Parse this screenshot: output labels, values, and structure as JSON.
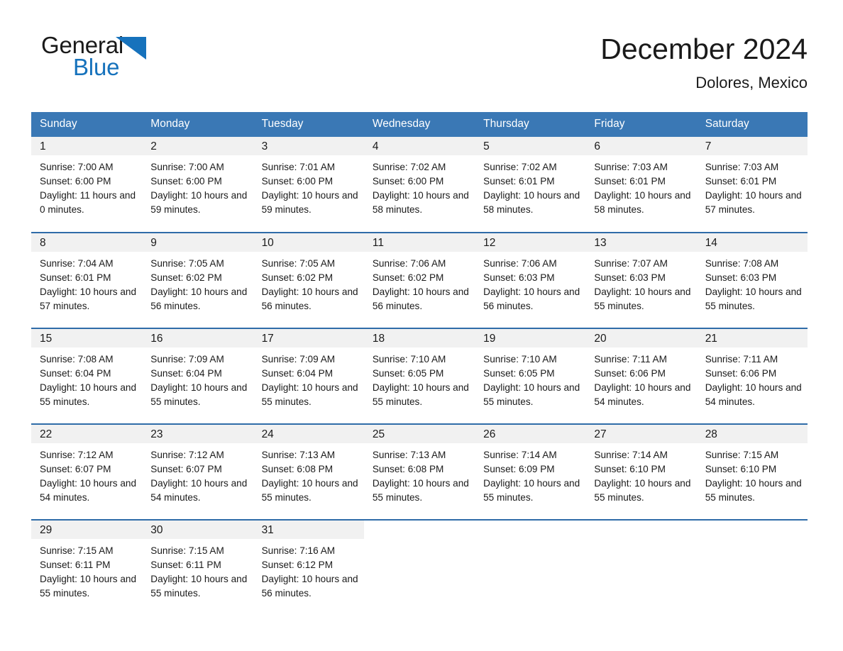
{
  "brand": {
    "name_part1": "General",
    "name_part2": "Blue",
    "triangle_color": "#1672bc"
  },
  "header": {
    "title": "December 2024",
    "location": "Dolores, Mexico"
  },
  "theme": {
    "header_bg": "#3a78b5",
    "header_text": "#ffffff",
    "week_divider": "#2f6ca8",
    "daynum_bg": "#f1f1f1",
    "text": "#1a1a1a"
  },
  "weekday_headers": [
    "Sunday",
    "Monday",
    "Tuesday",
    "Wednesday",
    "Thursday",
    "Friday",
    "Saturday"
  ],
  "weeks": [
    [
      {
        "day": "1",
        "sunrise": "Sunrise: 7:00 AM",
        "sunset": "Sunset: 6:00 PM",
        "daylight": "Daylight: 11 hours and 0 minutes."
      },
      {
        "day": "2",
        "sunrise": "Sunrise: 7:00 AM",
        "sunset": "Sunset: 6:00 PM",
        "daylight": "Daylight: 10 hours and 59 minutes."
      },
      {
        "day": "3",
        "sunrise": "Sunrise: 7:01 AM",
        "sunset": "Sunset: 6:00 PM",
        "daylight": "Daylight: 10 hours and 59 minutes."
      },
      {
        "day": "4",
        "sunrise": "Sunrise: 7:02 AM",
        "sunset": "Sunset: 6:00 PM",
        "daylight": "Daylight: 10 hours and 58 minutes."
      },
      {
        "day": "5",
        "sunrise": "Sunrise: 7:02 AM",
        "sunset": "Sunset: 6:01 PM",
        "daylight": "Daylight: 10 hours and 58 minutes."
      },
      {
        "day": "6",
        "sunrise": "Sunrise: 7:03 AM",
        "sunset": "Sunset: 6:01 PM",
        "daylight": "Daylight: 10 hours and 58 minutes."
      },
      {
        "day": "7",
        "sunrise": "Sunrise: 7:03 AM",
        "sunset": "Sunset: 6:01 PM",
        "daylight": "Daylight: 10 hours and 57 minutes."
      }
    ],
    [
      {
        "day": "8",
        "sunrise": "Sunrise: 7:04 AM",
        "sunset": "Sunset: 6:01 PM",
        "daylight": "Daylight: 10 hours and 57 minutes."
      },
      {
        "day": "9",
        "sunrise": "Sunrise: 7:05 AM",
        "sunset": "Sunset: 6:02 PM",
        "daylight": "Daylight: 10 hours and 56 minutes."
      },
      {
        "day": "10",
        "sunrise": "Sunrise: 7:05 AM",
        "sunset": "Sunset: 6:02 PM",
        "daylight": "Daylight: 10 hours and 56 minutes."
      },
      {
        "day": "11",
        "sunrise": "Sunrise: 7:06 AM",
        "sunset": "Sunset: 6:02 PM",
        "daylight": "Daylight: 10 hours and 56 minutes."
      },
      {
        "day": "12",
        "sunrise": "Sunrise: 7:06 AM",
        "sunset": "Sunset: 6:03 PM",
        "daylight": "Daylight: 10 hours and 56 minutes."
      },
      {
        "day": "13",
        "sunrise": "Sunrise: 7:07 AM",
        "sunset": "Sunset: 6:03 PM",
        "daylight": "Daylight: 10 hours and 55 minutes."
      },
      {
        "day": "14",
        "sunrise": "Sunrise: 7:08 AM",
        "sunset": "Sunset: 6:03 PM",
        "daylight": "Daylight: 10 hours and 55 minutes."
      }
    ],
    [
      {
        "day": "15",
        "sunrise": "Sunrise: 7:08 AM",
        "sunset": "Sunset: 6:04 PM",
        "daylight": "Daylight: 10 hours and 55 minutes."
      },
      {
        "day": "16",
        "sunrise": "Sunrise: 7:09 AM",
        "sunset": "Sunset: 6:04 PM",
        "daylight": "Daylight: 10 hours and 55 minutes."
      },
      {
        "day": "17",
        "sunrise": "Sunrise: 7:09 AM",
        "sunset": "Sunset: 6:04 PM",
        "daylight": "Daylight: 10 hours and 55 minutes."
      },
      {
        "day": "18",
        "sunrise": "Sunrise: 7:10 AM",
        "sunset": "Sunset: 6:05 PM",
        "daylight": "Daylight: 10 hours and 55 minutes."
      },
      {
        "day": "19",
        "sunrise": "Sunrise: 7:10 AM",
        "sunset": "Sunset: 6:05 PM",
        "daylight": "Daylight: 10 hours and 55 minutes."
      },
      {
        "day": "20",
        "sunrise": "Sunrise: 7:11 AM",
        "sunset": "Sunset: 6:06 PM",
        "daylight": "Daylight: 10 hours and 54 minutes."
      },
      {
        "day": "21",
        "sunrise": "Sunrise: 7:11 AM",
        "sunset": "Sunset: 6:06 PM",
        "daylight": "Daylight: 10 hours and 54 minutes."
      }
    ],
    [
      {
        "day": "22",
        "sunrise": "Sunrise: 7:12 AM",
        "sunset": "Sunset: 6:07 PM",
        "daylight": "Daylight: 10 hours and 54 minutes."
      },
      {
        "day": "23",
        "sunrise": "Sunrise: 7:12 AM",
        "sunset": "Sunset: 6:07 PM",
        "daylight": "Daylight: 10 hours and 54 minutes."
      },
      {
        "day": "24",
        "sunrise": "Sunrise: 7:13 AM",
        "sunset": "Sunset: 6:08 PM",
        "daylight": "Daylight: 10 hours and 55 minutes."
      },
      {
        "day": "25",
        "sunrise": "Sunrise: 7:13 AM",
        "sunset": "Sunset: 6:08 PM",
        "daylight": "Daylight: 10 hours and 55 minutes."
      },
      {
        "day": "26",
        "sunrise": "Sunrise: 7:14 AM",
        "sunset": "Sunset: 6:09 PM",
        "daylight": "Daylight: 10 hours and 55 minutes."
      },
      {
        "day": "27",
        "sunrise": "Sunrise: 7:14 AM",
        "sunset": "Sunset: 6:10 PM",
        "daylight": "Daylight: 10 hours and 55 minutes."
      },
      {
        "day": "28",
        "sunrise": "Sunrise: 7:15 AM",
        "sunset": "Sunset: 6:10 PM",
        "daylight": "Daylight: 10 hours and 55 minutes."
      }
    ],
    [
      {
        "day": "29",
        "sunrise": "Sunrise: 7:15 AM",
        "sunset": "Sunset: 6:11 PM",
        "daylight": "Daylight: 10 hours and 55 minutes."
      },
      {
        "day": "30",
        "sunrise": "Sunrise: 7:15 AM",
        "sunset": "Sunset: 6:11 PM",
        "daylight": "Daylight: 10 hours and 55 minutes."
      },
      {
        "day": "31",
        "sunrise": "Sunrise: 7:16 AM",
        "sunset": "Sunset: 6:12 PM",
        "daylight": "Daylight: 10 hours and 56 minutes."
      },
      null,
      null,
      null,
      null
    ]
  ]
}
